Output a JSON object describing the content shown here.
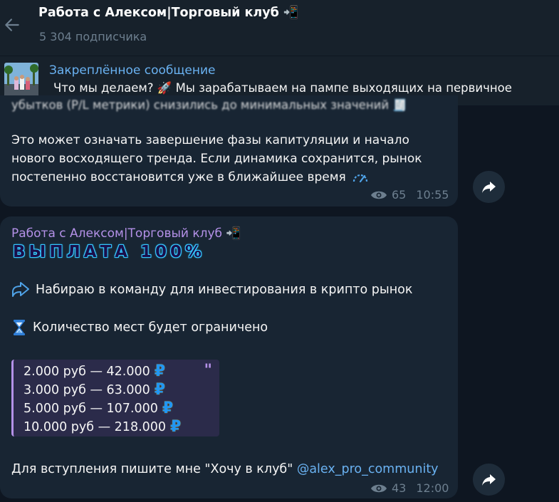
{
  "header": {
    "title": "Работа с Алексом|Торговый клуб 📲",
    "subscribers": "5 304 подписчика"
  },
  "pinned": {
    "title": "Закреплённое сообщение",
    "text": "Что мы делаем? 🚀  Мы зарабатываем на пампе выходящих на первичное"
  },
  "message1": {
    "partial_line": "убытков (P/L метрики) снизились до минимальных значений 🧾",
    "lines": [
      "Это может означать завершение фазы капитуляции и начало",
      "нового восходящего тренда. Если динамика сохранится, рынок",
      "постепенно восстановится уже в ближайшее время"
    ],
    "views": "65",
    "time": "10:55"
  },
  "message2": {
    "sender": "Работа с Алексом|Торговый клуб 📲",
    "payout": "ВЫПЛАТА 100%",
    "line1": "Набираю в команду для инвестирования в крипто рынок",
    "line2": "Количество мест будет ограничено",
    "quote": [
      "2.000 руб — 42.000",
      "3.000 руб — 63.000",
      "5.000 руб — 107.000",
      "10.000 руб — 218.000"
    ],
    "quote_mark": "\"",
    "rub_symbol": "₽",
    "join_text": "Для вступления пишите мне \"Хочу в клуб\" ",
    "mention": "@alex_pro_community",
    "views": "43",
    "time": "12:00"
  },
  "colors": {
    "background": "#0e1621",
    "header": "#17212b",
    "bubble": "#182533",
    "accent_blue": "#6ab2f2",
    "accent_purple": "#b491e8",
    "muted": "#6d7f8f"
  }
}
